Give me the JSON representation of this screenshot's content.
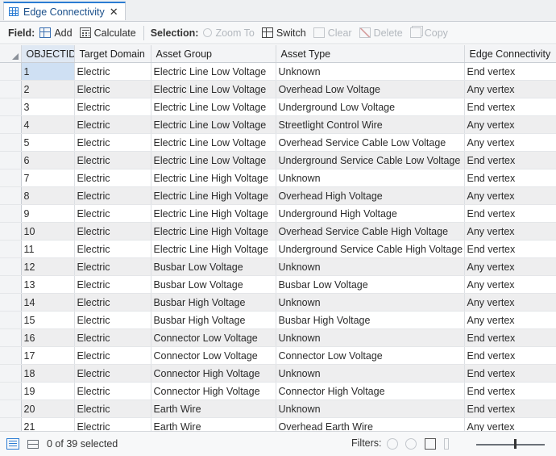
{
  "tab": {
    "title": "Edge Connectivity",
    "icon": "table-icon",
    "close": "✕"
  },
  "toolbar": {
    "field_label": "Field:",
    "add_label": "Add",
    "calculate_label": "Calculate",
    "selection_label": "Selection:",
    "zoom_to_label": "Zoom To",
    "switch_label": "Switch",
    "clear_label": "Clear",
    "delete_label": "Delete",
    "copy_label": "Copy"
  },
  "table": {
    "columns": [
      "OBJECTID",
      "Target Domain",
      "Asset Group",
      "Asset Type",
      "Edge Connectivity"
    ],
    "rows": [
      [
        "1",
        "Electric",
        "Electric Line Low Voltage",
        "Unknown",
        "End vertex"
      ],
      [
        "2",
        "Electric",
        "Electric Line Low Voltage",
        "Overhead Low Voltage",
        "Any vertex"
      ],
      [
        "3",
        "Electric",
        "Electric Line Low Voltage",
        "Underground Low Voltage",
        "End vertex"
      ],
      [
        "4",
        "Electric",
        "Electric Line Low Voltage",
        "Streetlight Control Wire",
        "Any vertex"
      ],
      [
        "5",
        "Electric",
        "Electric Line Low Voltage",
        "Overhead Service Cable Low Voltage",
        "Any vertex"
      ],
      [
        "6",
        "Electric",
        "Electric Line Low Voltage",
        "Underground Service Cable Low Voltage",
        "End vertex"
      ],
      [
        "7",
        "Electric",
        "Electric Line High Voltage",
        "Unknown",
        "End vertex"
      ],
      [
        "8",
        "Electric",
        "Electric Line High Voltage",
        "Overhead High Voltage",
        "Any vertex"
      ],
      [
        "9",
        "Electric",
        "Electric Line High Voltage",
        "Underground High Voltage",
        "End vertex"
      ],
      [
        "10",
        "Electric",
        "Electric Line High Voltage",
        "Overhead Service Cable High Voltage",
        "Any vertex"
      ],
      [
        "11",
        "Electric",
        "Electric Line High Voltage",
        "Underground Service Cable High Voltage",
        "End vertex"
      ],
      [
        "12",
        "Electric",
        "Busbar Low Voltage",
        "Unknown",
        "Any vertex"
      ],
      [
        "13",
        "Electric",
        "Busbar Low Voltage",
        "Busbar Low Voltage",
        "Any vertex"
      ],
      [
        "14",
        "Electric",
        "Busbar High Voltage",
        "Unknown",
        "Any vertex"
      ],
      [
        "15",
        "Electric",
        "Busbar High Voltage",
        "Busbar High Voltage",
        "Any vertex"
      ],
      [
        "16",
        "Electric",
        "Connector Low Voltage",
        "Unknown",
        "End vertex"
      ],
      [
        "17",
        "Electric",
        "Connector Low Voltage",
        "Connector Low Voltage",
        "End vertex"
      ],
      [
        "18",
        "Electric",
        "Connector High Voltage",
        "Unknown",
        "End vertex"
      ],
      [
        "19",
        "Electric",
        "Connector High Voltage",
        "Connector High Voltage",
        "End vertex"
      ],
      [
        "20",
        "Electric",
        "Earth Wire",
        "Unknown",
        "End vertex"
      ],
      [
        "21",
        "Electric",
        "Earth Wire",
        "Overhead Earth Wire",
        "Any vertex"
      ]
    ]
  },
  "status": {
    "selected_text": "0 of 39 selected",
    "filters_label": "Filters:"
  }
}
